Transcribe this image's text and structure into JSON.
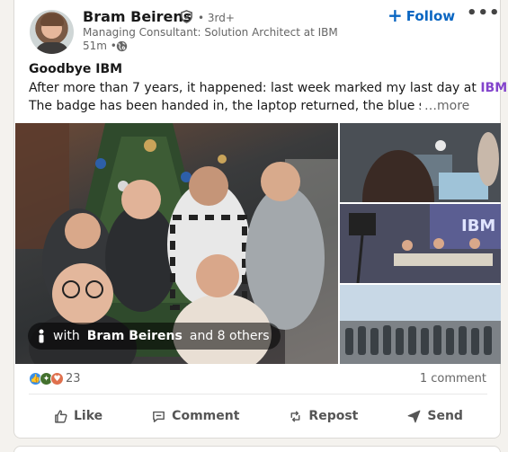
{
  "post": {
    "author": {
      "name": "Bram Beirens",
      "degree": "• 3rd+",
      "headline": "Managing Consultant: Solution Architect at IBM",
      "time": "51m •"
    },
    "follow_label": "Follow",
    "more_label": "•••",
    "title": "Goodbye IBM",
    "body_line1_prefix": "After more than 7 years, it happened: last week marked my last day at ",
    "body_hashtag": "IBM",
    "body_line1_suffix": ".",
    "body_line2": "The badge has been handed in, the laptop returned, the blue suit",
    "see_more": "…more",
    "photo_tag": {
      "prefix": "with",
      "person": "Bram Beirens",
      "suffix": "and 8 others"
    }
  },
  "social": {
    "reaction_count": "23",
    "comments": "1 comment"
  },
  "actions": {
    "like": "Like",
    "comment": "Comment",
    "repost": "Repost",
    "send": "Send"
  },
  "colors": {
    "accent": "#0a66c2",
    "hashtag": "#8344cc",
    "like_blue": "#378fe9",
    "celebrate_green": "#44712e",
    "love_red": "#df704d"
  },
  "icons": {
    "verified": "shield-check-icon",
    "visibility": "globe-icon",
    "like": "thumbs-up-icon",
    "comment": "speech-bubble-icon",
    "repost": "repost-arrows-icon",
    "send": "paper-plane-icon"
  }
}
